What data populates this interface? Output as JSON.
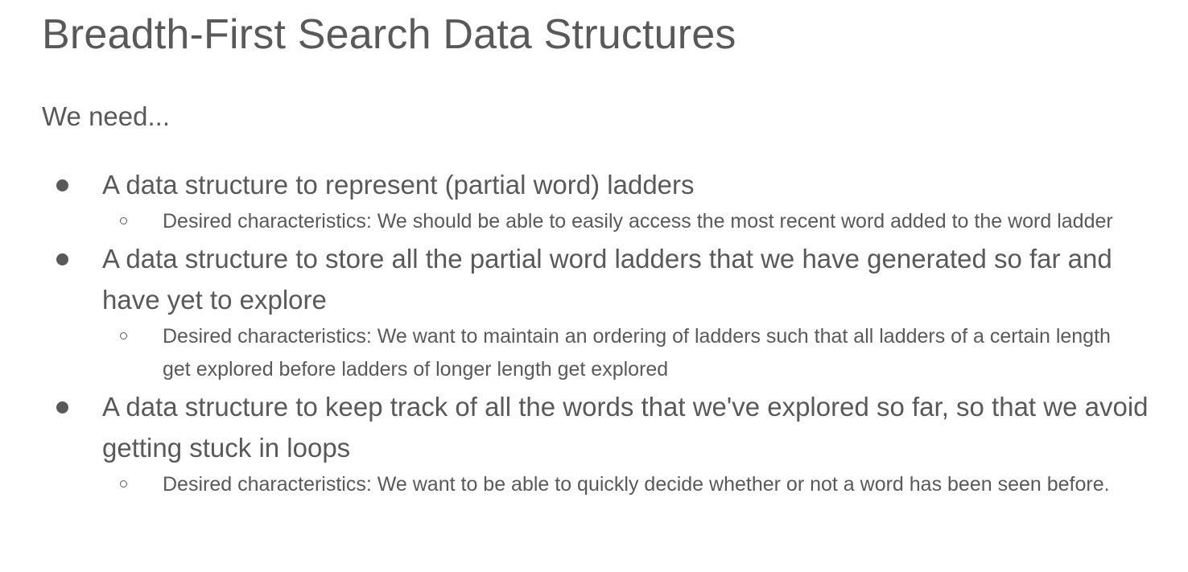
{
  "slide": {
    "title": "Breadth-First Search Data Structures",
    "intro": "We need...",
    "bullets": [
      {
        "text": "A data structure to represent (partial word) ladders",
        "sub": "Desired characteristics: We should be able to easily access the most recent word added to the word ladder"
      },
      {
        "text": "A data structure to store all the partial word ladders that we have generated so far and have yet to explore",
        "sub": "Desired characteristics: We want to maintain an ordering of ladders such that all ladders of a certain length get explored before ladders of longer length get explored"
      },
      {
        "text": "A data structure to keep track of all the words that we've explored so far, so that we avoid getting stuck in loops",
        "sub": "Desired characteristics: We want to be able to quickly decide whether or not a word has been seen before."
      }
    ]
  },
  "colors": {
    "text": "#595959",
    "background": "#ffffff"
  },
  "icons": {
    "bullet": "filled-circle-bullet-icon",
    "sub_bullet": "hollow-circle-bullet-icon"
  }
}
